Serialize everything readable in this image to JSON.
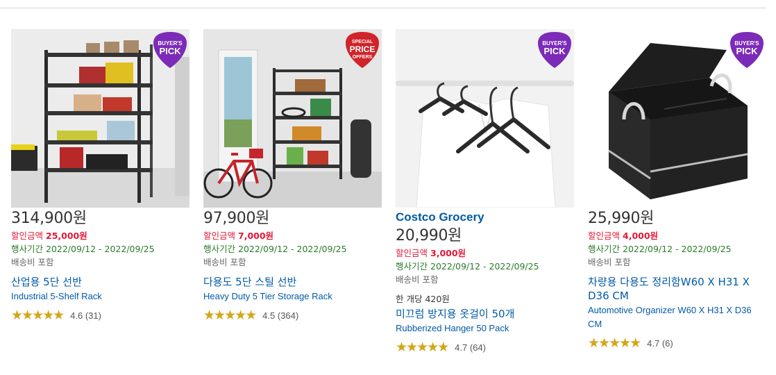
{
  "products": [
    {
      "badge": "BUYER'S PICK",
      "price": "314,900원",
      "discount_label": "할인금액",
      "discount_amount": "25,000원",
      "period_label": "행사기간",
      "period": "2022/09/12 - 2022/09/25",
      "shipping": "배송비 포함",
      "title_ko": "산업용 5단 선반",
      "title_en": "Industrial 5-Shelf Rack",
      "stars": "★★★★★",
      "rating": "4.6 (31)"
    },
    {
      "badge": "SPECIAL PRICE OFFERS",
      "price": "97,900원",
      "discount_label": "할인금액",
      "discount_amount": "7,000원",
      "period_label": "행사기간",
      "period": "2022/09/12 - 2022/09/25",
      "shipping": "배송비 포함",
      "title_ko": "다용도 5단 스틸 선반",
      "title_en": "Heavy Duty 5 Tier Storage Rack",
      "stars": "★★★★★",
      "rating": "4.5 (364)"
    },
    {
      "badge": "BUYER'S PICK",
      "brand": "Costco Grocery",
      "price": "20,990원",
      "discount_label": "할인금액",
      "discount_amount": "3,000원",
      "period_label": "행사기간",
      "period": "2022/09/12 - 2022/09/25",
      "shipping": "배송비 포함",
      "unit_price": "한 개당 420원",
      "title_ko": "미끄럼 방지용 옷걸이 50개",
      "title_en": "Rubberized Hanger 50 Pack",
      "stars": "★★★★★",
      "rating": "4.7 (64)"
    },
    {
      "badge": "BUYER'S PICK",
      "price": "25,990원",
      "discount_label": "할인금액",
      "discount_amount": "4,000원",
      "period_label": "행사기간",
      "period": "2022/09/12 - 2022/09/25",
      "shipping": "배송비 포함",
      "title_ko": "차량용 다용도 정리함W60 X H31 X D36 CM",
      "title_en": "Automotive Organizer W60 X H31 X D36 CM",
      "stars": "★★★★★",
      "rating": "4.7 (6)"
    }
  ],
  "colors": {
    "price_discount": "#e31837",
    "period": "#2a7b2a",
    "link": "#005aa6",
    "star": "#d4a617",
    "buyers_pick": "#7b2bb8",
    "special_price": "#d0232a"
  }
}
